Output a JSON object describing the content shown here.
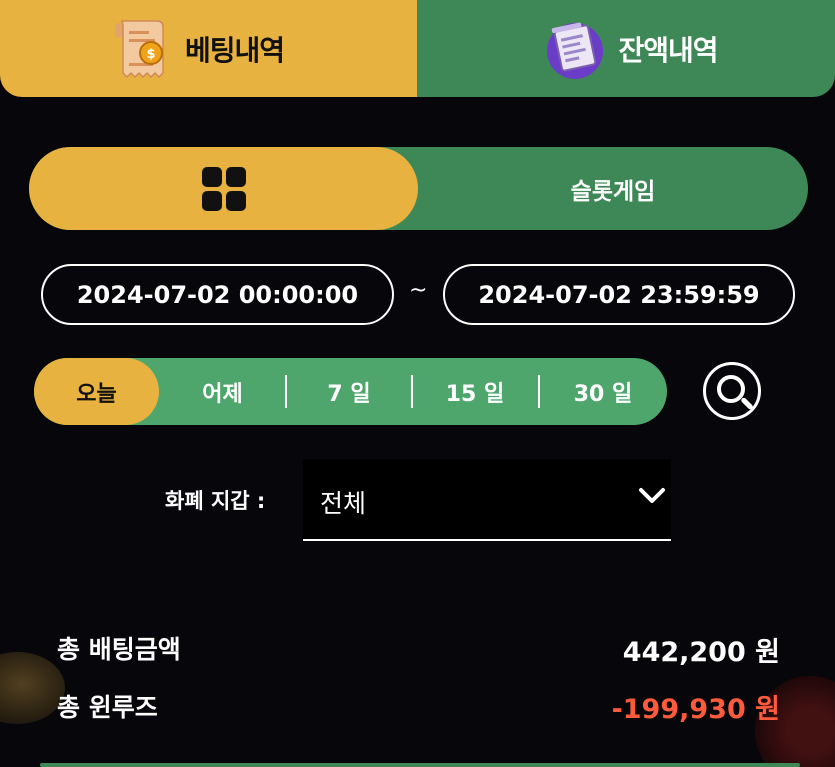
{
  "tabs": {
    "betting_history": "베팅내역",
    "balance_history": "잔액내역"
  },
  "category": {
    "all_icon": "grid-icon",
    "slot_label": "슬롯게임"
  },
  "date_range": {
    "start": "2024-07-02 00:00:00",
    "separator": "~",
    "end": "2024-07-02 23:59:59"
  },
  "period": {
    "items": [
      "오늘",
      "어제",
      "7 일",
      "15 일",
      "30 일"
    ],
    "selected": "오늘"
  },
  "wallet": {
    "label": "화폐 지갑 :",
    "value": "전체"
  },
  "summary": {
    "total_bet_label": "총 배팅금액",
    "total_bet_value": "442,200 원",
    "total_winloss_label": "총 윈루즈",
    "total_winloss_value": "-199,930 원"
  },
  "colors": {
    "accent_yellow": "#e7b23f",
    "accent_green": "#3e8857",
    "light_green": "#4fa66c",
    "negative_red": "#ff5a3c",
    "background": "#07070b"
  }
}
